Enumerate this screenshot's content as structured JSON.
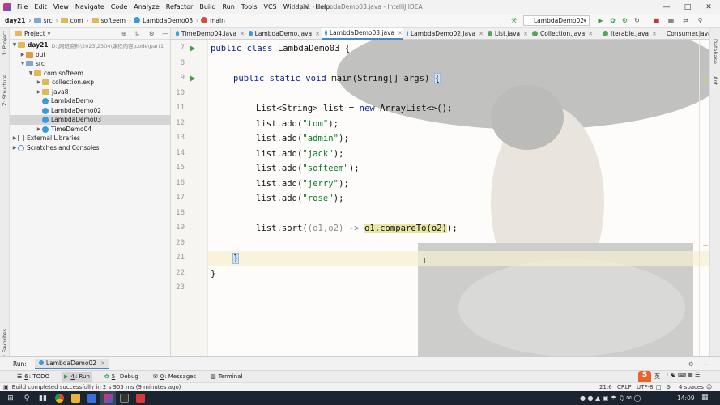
{
  "menu": {
    "items": [
      "File",
      "Edit",
      "View",
      "Navigate",
      "Code",
      "Analyze",
      "Refactor",
      "Build",
      "Run",
      "Tools",
      "VCS",
      "Window",
      "Help"
    ],
    "window_title": "day21 - LambdaDemo03.java - IntelliJ IDEA"
  },
  "breadcrumb": [
    "day21",
    "src",
    "com",
    "softeem",
    "LambdaDemo03",
    "main"
  ],
  "run_config": "LambdaDemo02",
  "left_strip": {
    "project": "1: Project",
    "structure": "Z: Structure",
    "favorites": "2: Favorites"
  },
  "right_strip": {
    "database": "Database",
    "ant": "Ant"
  },
  "project_panel": {
    "title": "Project",
    "tree": [
      {
        "label": "day21",
        "detail": "D:\\网班资料\\2023\\2304\\课程内容\\code\\part1"
      },
      {
        "label": "out"
      },
      {
        "label": "src"
      },
      {
        "label": "com.softeem"
      },
      {
        "label": "collection.exp"
      },
      {
        "label": "java8"
      },
      {
        "label": "LambdaDemo"
      },
      {
        "label": "LambdaDemo02"
      },
      {
        "label": "LambdaDemo03"
      },
      {
        "label": "TimeDemo04"
      },
      {
        "label": "External Libraries"
      },
      {
        "label": "Scratches and Consoles"
      }
    ]
  },
  "tabs": [
    "TimeDemo04.java",
    "LambdaDemo.java",
    "LambdaDemo03.java",
    "LambdaDemo02.java",
    "List.java",
    "Collection.java",
    "Iterable.java",
    "Consumer.java"
  ],
  "active_tab": "LambdaDemo03.java",
  "editor": {
    "line_numbers": [
      "7",
      "8",
      "9",
      "10",
      "11",
      "12",
      "13",
      "14",
      "15",
      "16",
      "17",
      "18",
      "19",
      "20",
      "21",
      "22",
      "23"
    ],
    "lines": {
      "l7": {
        "kw": "public class ",
        "rest": "LambdaDemo03 {"
      },
      "l9": {
        "kw": "public static void ",
        "rest": "main(String[] args) ",
        "brace": "{"
      },
      "l11": {
        "a": "List<String> list = ",
        "kw": "new ",
        "b": "ArrayList<>();"
      },
      "adds": [
        {
          "pre": "list.add(",
          "str": "\"tom\"",
          "post": ");"
        },
        {
          "pre": "list.add(",
          "str": "\"admin\"",
          "post": ");"
        },
        {
          "pre": "list.add(",
          "str": "\"jack\"",
          "post": ");"
        },
        {
          "pre": "list.add(",
          "str": "\"softeem\"",
          "post": ");"
        },
        {
          "pre": "list.add(",
          "str": "\"jerry\"",
          "post": ");"
        },
        {
          "pre": "list.add(",
          "str": "\"rose\"",
          "post": ");"
        }
      ],
      "l19": {
        "a": "list.sort(",
        "lam": "(o1,o2) -> ",
        "hl": "o1.compareTo(o2)",
        "b": ");"
      },
      "l21": "}",
      "l22": "}"
    }
  },
  "run_bar": {
    "label": "Run:",
    "config": "LambdaDemo02"
  },
  "tool_windows": [
    {
      "num": "6",
      "label": ": TODO"
    },
    {
      "num": "4",
      "label": ": Run"
    },
    {
      "num": "5",
      "label": ": Debug"
    },
    {
      "num": "0",
      "label": ": Messages"
    },
    {
      "num": "",
      "label": "Terminal"
    }
  ],
  "status": {
    "message": "Build completed successfully in 2 s 905 ms (9 minutes ago)",
    "position": "21:6",
    "line_sep": "CRLF",
    "encoding": "UTF-8",
    "indent": "4 spaces"
  },
  "taskbar": {
    "ime": "英",
    "time": "14:09"
  },
  "colors": {
    "keyword": "#0a1f8f",
    "string": "#0a7d25",
    "run_green": "#3aa142",
    "highlight": "#e8e6a5"
  }
}
